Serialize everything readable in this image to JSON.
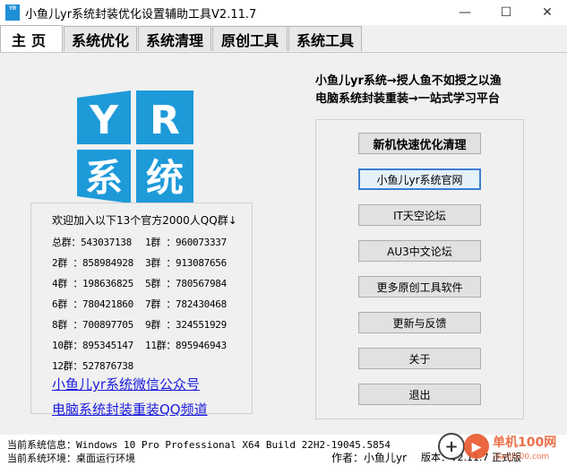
{
  "window": {
    "title": "小鱼儿yr系统封装优化设置辅助工具V2.11.7",
    "icon_text": "YR",
    "min_glyph": "—",
    "max_glyph": "☐",
    "close_glyph": "✕"
  },
  "tabs": [
    {
      "label": "主页"
    },
    {
      "label": "系统优化"
    },
    {
      "label": "系统清理"
    },
    {
      "label": "原创工具"
    },
    {
      "label": "系统工具"
    }
  ],
  "logo": {
    "letters": [
      "Y",
      "R",
      "系",
      "统"
    ],
    "color": "#1e9ad9"
  },
  "slogan": {
    "line1": "小鱼儿yr系统→授人鱼不如授之以渔",
    "line2": "电脑系统封装重装→一站式学习平台"
  },
  "qq": {
    "heading": "欢迎加入以下13个官方2000人QQ群↓",
    "rows": [
      {
        "left": "总群：543037138",
        "right": "1群 ：960073337"
      },
      {
        "left": "2群 ：858984928",
        "right": "3群 ：913087656"
      },
      {
        "left": "4群 ：198636825",
        "right": "5群 ：780567984"
      },
      {
        "left": "6群 ：780421860",
        "right": "7群 ：782430468"
      },
      {
        "left": "8群 ：700897705",
        "right": "9群 ：324551929"
      },
      {
        "left": "10群：895345147",
        "right": "11群：895946943"
      },
      {
        "left": "12群：527876738",
        "right": ""
      }
    ]
  },
  "links": {
    "wechat": "小鱼儿yr系统微信公众号",
    "channel": "电脑系统封装重装QQ频道"
  },
  "buttons": {
    "quick_optimize": "新机快速优化清理",
    "website": "小鱼儿yr系统官网",
    "it_forum": "IT天空论坛",
    "au3_forum": "AU3中文论坛",
    "more_tools": "更多原创工具软件",
    "update": "更新与反馈",
    "about": "关于",
    "exit": "退出"
  },
  "status": {
    "sysinfo": "当前系统信息：Windows 10 Pro Professional X64 Build 22H2-19045.5854",
    "env": "当前系统环境：桌面运行环境",
    "author": "作者：小鱼儿yr",
    "version": "版本：V2.11.7 正式版"
  },
  "watermark": {
    "text": "单机100网",
    "sub": "danji100.com"
  }
}
